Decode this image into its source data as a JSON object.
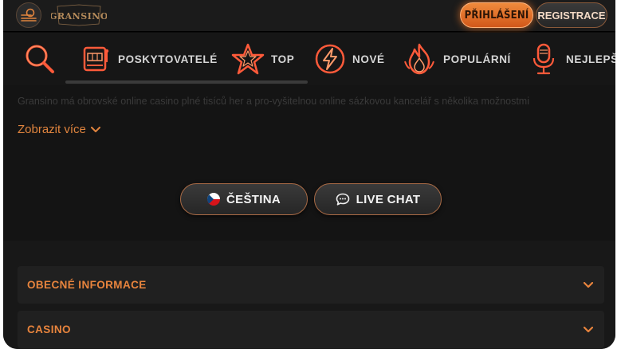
{
  "header": {
    "logo_text": "GRANSINO",
    "login_label": "PŘIHLÁŠENÍ",
    "register_label": "REGISTRACE"
  },
  "categories": [
    {
      "id": "search",
      "label": ""
    },
    {
      "id": "providers",
      "label": "POSKYTOVATELÉ"
    },
    {
      "id": "top",
      "label": "TOP"
    },
    {
      "id": "new",
      "label": "NOVÉ"
    },
    {
      "id": "popular",
      "label": "POPULÁRNÍ"
    },
    {
      "id": "best",
      "label": "NEJLEPŠÍ"
    }
  ],
  "description": {
    "text": "Gransino má obrovské online casino plné tisíců her a pro-vyšitelnou online sázkovou kancelář s několika možnostmi",
    "show_more_label": "Zobrazit více"
  },
  "buttons": {
    "language_label": "ČEŠTINA",
    "live_chat_label": "LIVE CHAT"
  },
  "accordion": [
    {
      "title": "OBECNÉ INFORMACE"
    },
    {
      "title": "CASINO"
    }
  ],
  "colors": {
    "accent": "#e8843d",
    "background": "#141414",
    "login_gradient_top": "#f08a3c",
    "login_gradient_bottom": "#d2581a"
  }
}
